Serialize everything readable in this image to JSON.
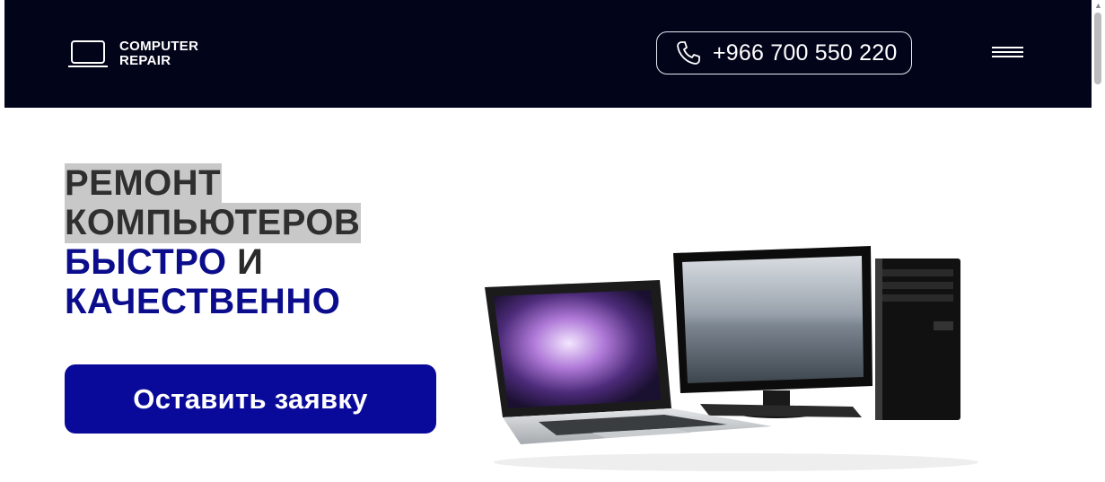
{
  "header": {
    "logo": {
      "line1": "COMPUTER",
      "line2": "REPAIR"
    },
    "phone": "+966 700 550 220",
    "menu_icon": "hamburger-menu-icon"
  },
  "hero": {
    "line1": "РЕМОНТ",
    "line2": "КОМПЬЮТЕРОВ",
    "word_fast": "БЫСТРО",
    "word_and": "И",
    "word_quality": "КАЧЕСТВЕННО",
    "cta_label": "Оставить заявку"
  },
  "colors": {
    "header_bg": "#020419",
    "accent_blue": "#0a0a9a",
    "highlight_bg": "#c8c8c8"
  }
}
